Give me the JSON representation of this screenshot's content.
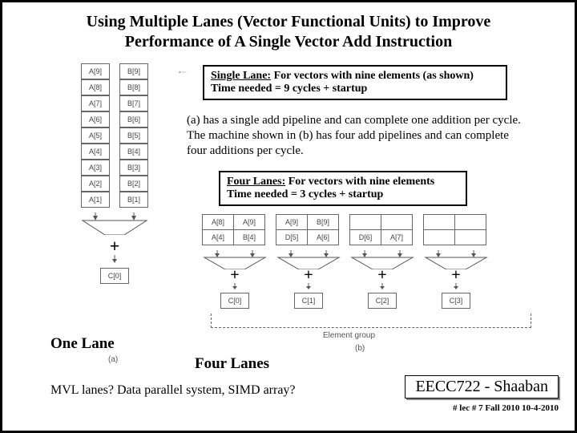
{
  "title_line1": "Using Multiple Lanes (Vector Functional Units) to Improve",
  "title_line2": "Performance of A Single Vector Add Instruction",
  "single_lane": {
    "A": [
      "A[9]",
      "A[8]",
      "A[7]",
      "A[6]",
      "A[5]",
      "A[4]",
      "A[3]",
      "A[2]",
      "A[1]"
    ],
    "B": [
      "B[9]",
      "B[8]",
      "B[7]",
      "B[6]",
      "B[5]",
      "B[4]",
      "B[3]",
      "B[2]",
      "B[1]"
    ],
    "out": "C[0]"
  },
  "note1_head": "Single Lane:",
  "note1_rest": " For vectors with nine elements (as shown)",
  "note1_line2": "Time needed = 9 cycles + startup",
  "desc": "(a) has a single add pipeline and can complete one addition per cycle. The machine shown in (b) has four add pipelines and can complete four additions per cycle.",
  "note2_head": "Four Lanes:",
  "note2_rest": " For vectors with nine elements",
  "note2_line2": "Time needed = 3 cycles + startup",
  "four_lane": {
    "groups": [
      {
        "top": [
          "A[8]",
          "A[9]"
        ],
        "bot": [
          "A[4]",
          "B[4]"
        ],
        "out": "C[0]"
      },
      {
        "top": [
          "A[9]",
          "B[9]"
        ],
        "bot": [
          "D[5]",
          "A[6]"
        ],
        "out": "C[1]"
      },
      {
        "top": [
          "",
          ""
        ],
        "bot": [
          "D[6]",
          "A[7]"
        ],
        "out": "C[2]"
      },
      {
        "top": [
          "",
          ""
        ],
        "bot": [
          "",
          ""
        ],
        "out": "C[3]"
      }
    ]
  },
  "elem_group": "Element group",
  "sub_a": "(a)",
  "sub_b": "(b)",
  "one_lane_lbl": "One Lane",
  "four_lane_lbl": "Four Lanes",
  "mvl": "MVL lanes?  Data parallel system, SIMD array?",
  "course": "EECC722 - Shaaban",
  "footer": "#  lec # 7     Fall 2010    10-4-2010",
  "plus": "+"
}
